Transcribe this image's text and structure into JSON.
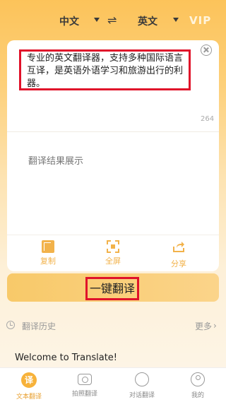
{
  "topbar": {
    "source_lang": "中文",
    "target_lang": "英文",
    "swap_icon": "⇌",
    "vip_label": "VIP"
  },
  "input": {
    "text": "专业的英文翻译器，支持多种国际语言互译，是英语外语学习和旅游出行的利器。",
    "char_count": "264"
  },
  "result": {
    "placeholder": "翻译结果展示"
  },
  "actions": {
    "copy": "复制",
    "fullscreen": "全屏",
    "share": "分享"
  },
  "translate_button": "一键翻译",
  "history": {
    "label": "翻译历史",
    "more": "更多",
    "chevron": "›"
  },
  "welcome_text": "Welcome to Translate!",
  "tabs": [
    {
      "label": "文本翻译",
      "icon": "translate-icon",
      "glyph": "译",
      "active": true
    },
    {
      "label": "拍照翻译",
      "icon": "camera-icon",
      "active": false
    },
    {
      "label": "对话翻译",
      "icon": "chat-icon",
      "active": false
    },
    {
      "label": "我的",
      "icon": "profile-icon",
      "active": false
    }
  ],
  "colors": {
    "accent": "#f7b23a",
    "highlight_border": "#e0122a"
  }
}
